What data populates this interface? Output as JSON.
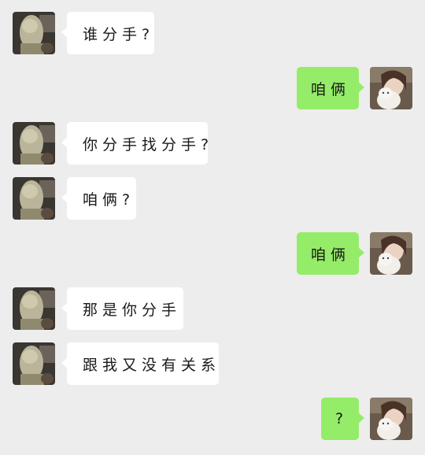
{
  "messages": [
    {
      "side": "left",
      "text": "谁分手?"
    },
    {
      "side": "right",
      "text": "咱俩"
    },
    {
      "side": "left",
      "text": "你分手找分手?"
    },
    {
      "side": "left",
      "text": "咱俩?"
    },
    {
      "side": "right",
      "text": "咱俩"
    },
    {
      "side": "left",
      "text": "那是你分手"
    },
    {
      "side": "left",
      "text": "跟我又没有关系"
    },
    {
      "side": "right",
      "text": "?"
    }
  ],
  "avatars": {
    "left": "contact-avatar",
    "right": "user-avatar"
  },
  "colors": {
    "background": "#ededed",
    "incoming_bubble": "#ffffff",
    "outgoing_bubble": "#95ec69"
  }
}
